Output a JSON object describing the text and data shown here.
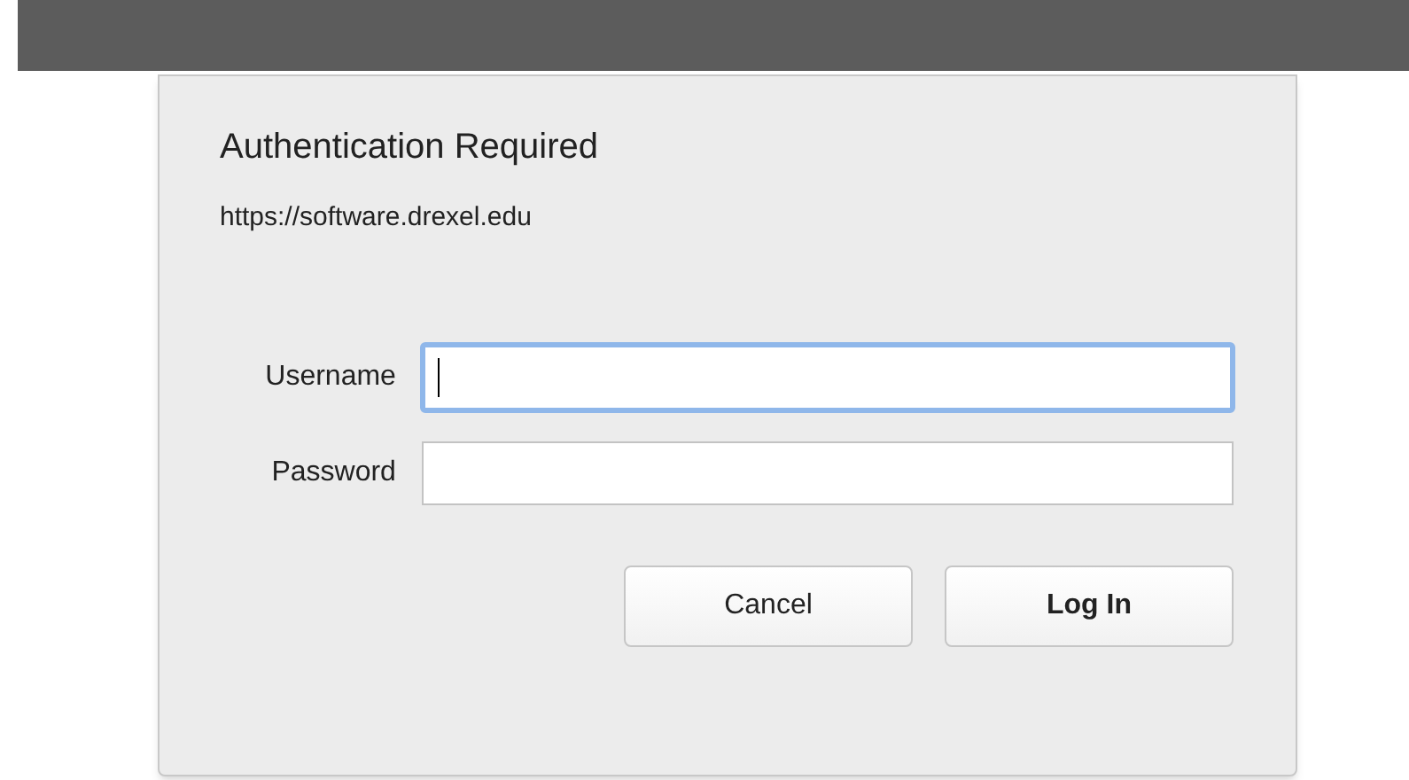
{
  "dialog": {
    "title": "Authentication Required",
    "url": "https://software.drexel.edu"
  },
  "fields": [
    {
      "label": "Username",
      "focused": true
    },
    {
      "label": "Password",
      "focused": false
    }
  ],
  "buttons": [
    {
      "label": "Cancel",
      "default": false
    },
    {
      "label": "Log In",
      "default": true
    }
  ]
}
